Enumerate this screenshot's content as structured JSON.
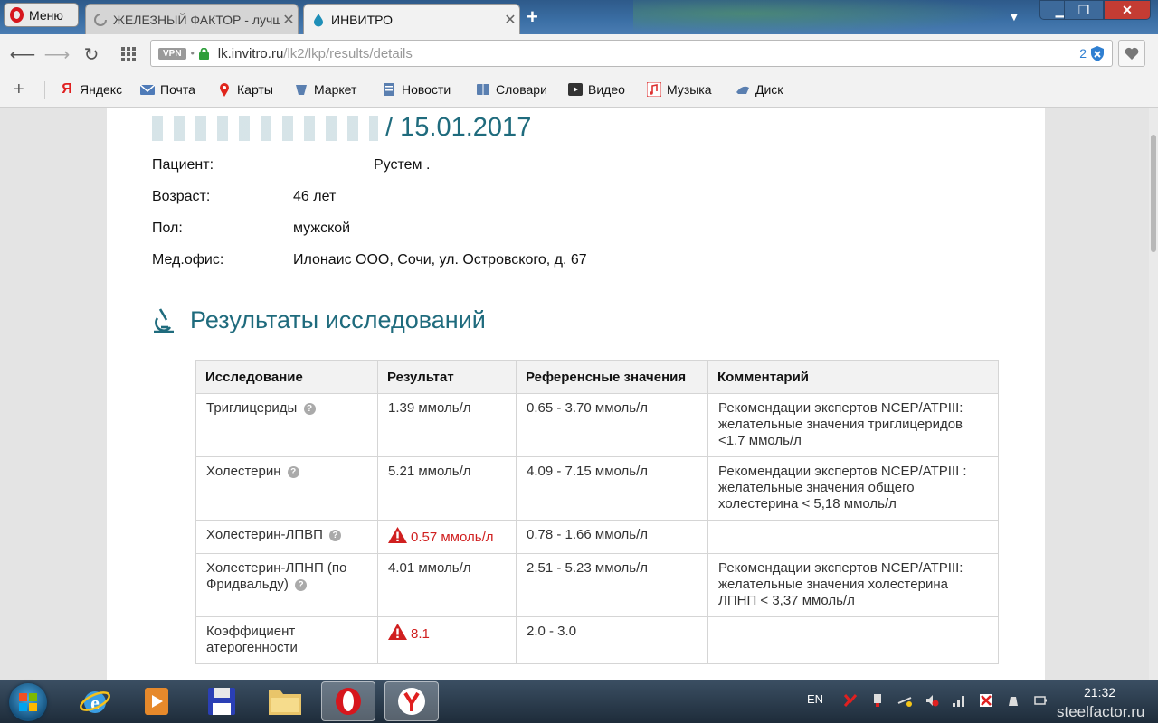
{
  "browser": {
    "menu_label": "Меню",
    "tabs": [
      {
        "label": "ЖЕЛЕЗНЫЙ ФАКТОР - лучшие"
      },
      {
        "label": "ИНВИТРО"
      }
    ],
    "url": {
      "host": "lk.invitro.ru",
      "path": "/lk2/lkp/results/details",
      "vpn": "VPN"
    },
    "ext_count": "2",
    "bookmarks": [
      {
        "label": "Яндекс",
        "icon": "yandex-icon"
      },
      {
        "label": "Почта",
        "icon": "mail-icon"
      },
      {
        "label": "Карты",
        "icon": "map-pin-icon"
      },
      {
        "label": "Маркет",
        "icon": "market-icon"
      },
      {
        "label": "Новости",
        "icon": "news-icon"
      },
      {
        "label": "Словари",
        "icon": "dictionary-icon"
      },
      {
        "label": "Видео",
        "icon": "video-icon"
      },
      {
        "label": "Музыка",
        "icon": "music-icon"
      },
      {
        "label": "Диск",
        "icon": "disk-icon"
      }
    ]
  },
  "page": {
    "order_date": "/ 15.01.2017",
    "info": {
      "patient_label": "Пациент:",
      "patient_value": "Рустем .",
      "age_label": "Возраст:",
      "age_value": "46 лет",
      "sex_label": "Пол:",
      "sex_value": "мужской",
      "office_label": "Мед.офис:",
      "office_value": "Илонаис ООО, Сочи, ул. Островского, д. 67"
    },
    "results_title": "Результаты исследований",
    "table": {
      "headers": [
        "Исследование",
        "Результат",
        "Референсные значения",
        "Комментарий"
      ],
      "rows": [
        {
          "test": "Триглицериды",
          "result": "1.39 ммоль/л",
          "abnormal": false,
          "reference": "0.65 - 3.70 ммоль/л",
          "comment": "Рекомендации экспертов NCEP/ATPIII: желательные значения триглицеридов <1.7 ммоль/л"
        },
        {
          "test": "Холестерин",
          "result": "5.21 ммоль/л",
          "abnormal": false,
          "reference": "4.09 - 7.15 ммоль/л",
          "comment": "Рекомендации экспертов NCEP/ATPIII : желательные значения общего холестерина < 5,18 ммоль/л"
        },
        {
          "test": "Холестерин-ЛПВП",
          "result": "0.57 ммоль/л",
          "abnormal": true,
          "reference": "0.78 - 1.66 ммоль/л",
          "comment": ""
        },
        {
          "test": "Холестерин-ЛПНП (по Фридвальду)",
          "result": "4.01 ммоль/л",
          "abnormal": false,
          "reference": "2.51 - 5.23 ммоль/л",
          "comment": "Рекомендации экспертов NCEP/ATPIII: желательные значения холестерина ЛПНП < 3,37 ммоль/л"
        },
        {
          "test": "Коэффициент атерогенности",
          "result": "8.1",
          "abnormal": true,
          "reference": "2.0 - 3.0",
          "comment": ""
        }
      ]
    }
  },
  "taskbar": {
    "lang": "EN",
    "time": "21:32",
    "watermark": "steelfactor.ru",
    "apps": [
      "internet-explorer-icon",
      "media-player-icon",
      "save-icon",
      "explorer-folder-icon",
      "opera-icon",
      "yandex-browser-icon"
    ]
  },
  "colors": {
    "accent": "#1f6b7d",
    "warning": "#d01f1f",
    "opera_red": "#d6161d"
  }
}
